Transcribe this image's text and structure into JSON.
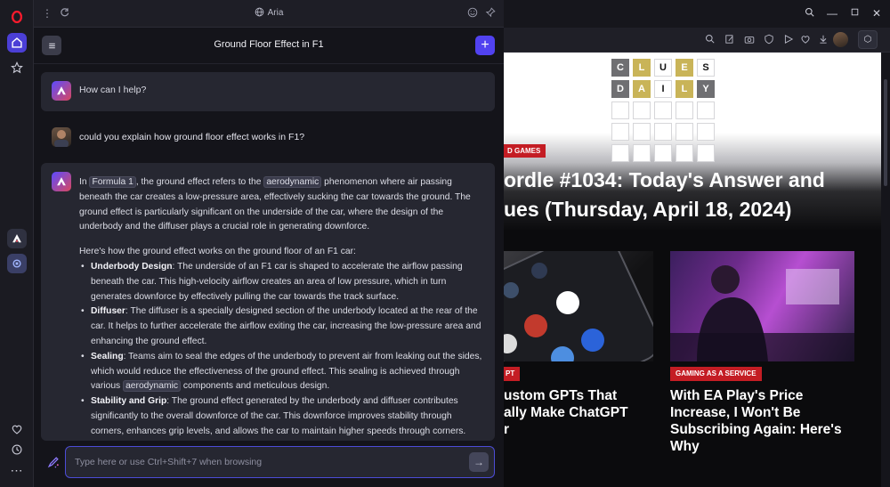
{
  "aria_panel": {
    "topbar_title": "Aria",
    "chat_title": "Ground Floor Effect in F1",
    "greeting": "How can I help?",
    "user_question": "could you explain how ground floor effect works in F1?",
    "answer": {
      "intro_pre": "In",
      "chip_formula": "Formula 1",
      "intro_mid": ", the ground effect refers to the",
      "chip_aero": "aerodynamic",
      "intro_post": "phenomenon where air passing beneath the car creates a low-pressure area, effectively sucking the car towards the ground. The ground effect is particularly significant on the underside of the car, where the design of the underbody and the diffuser plays a crucial role in generating downforce.",
      "lead": "Here's how the ground effect works on the ground floor of an F1 car:",
      "items": [
        {
          "title": "Underbody Design",
          "text": ": The underside of an F1 car is shaped to accelerate the airflow passing beneath the car. This high-velocity airflow creates an area of low pressure, which in turn generates downforce by effectively pulling the car towards the track surface."
        },
        {
          "title": "Diffuser",
          "text": ": The diffuser is a specially designed section of the underbody located at the rear of the car. It helps to further accelerate the airflow exiting the car, increasing the low-pressure area and enhancing the ground effect."
        },
        {
          "title": "Sealing",
          "text_pre": ": Teams aim to seal the edges of the underbody to prevent air from leaking out the sides, which would reduce the effectiveness of the ground effect. This sealing is achieved through various",
          "chip": "aerodynamic",
          "text_post": "components and meticulous design."
        },
        {
          "title": "Stability and Grip",
          "text": ": The ground effect generated by the underbody and diffuser contributes significantly to the overall downforce of the car. This downforce improves stability through corners, enhances grip levels, and allows the car to maintain higher speeds through corners."
        }
      ]
    },
    "composer_placeholder": "Type here or use Ctrl+Shift+7 when browsing"
  },
  "page": {
    "hero_badge": "D GAMES",
    "hero_title_1": "ordle #1034: Today's Answer and",
    "hero_title_2": "ues (Thursday, April 18, 2024)",
    "grid_row1": [
      "C",
      "L",
      "U",
      "E",
      "S"
    ],
    "grid_row2": [
      "D",
      "A",
      "I",
      "L",
      "Y"
    ],
    "card_left_badge": "PT",
    "card_left_title": "ustom GPTs That\nally Make ChatGPT\nr",
    "card_right_badge": "GAMING AS A SERVICE",
    "card_right_title": "With EA Play's Price Increase, I Won't Be Subscribing Again: Here's Why"
  },
  "colors": {
    "accent": "#5142f0",
    "badge_red": "#c41d24",
    "wordle_yellow": "#c9b458",
    "wordle_gray": "#6f6f72"
  }
}
